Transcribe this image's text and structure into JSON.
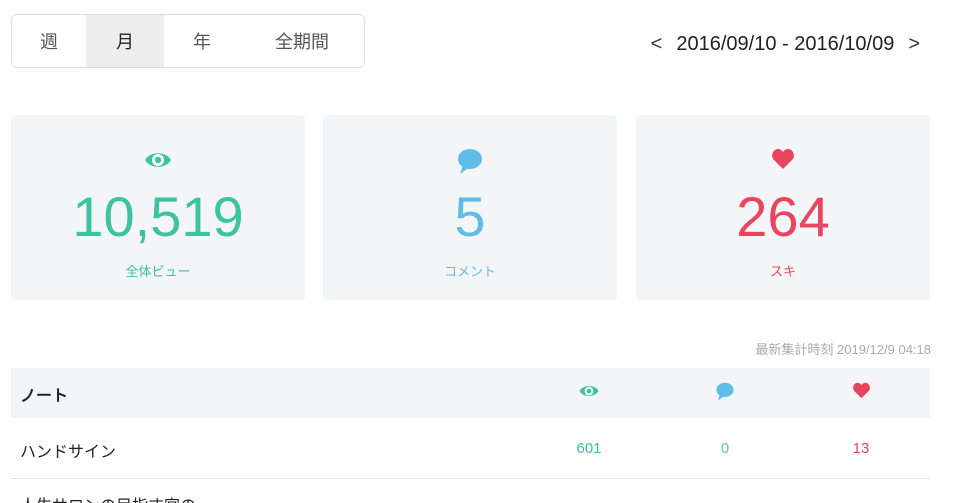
{
  "period_tabs": [
    {
      "label": "週",
      "active": false
    },
    {
      "label": "月",
      "active": true
    },
    {
      "label": "年",
      "active": false
    },
    {
      "label": "全期間",
      "active": false
    }
  ],
  "date_range": {
    "prev": "<",
    "text": "2016/09/10 - 2016/10/09",
    "next": ">"
  },
  "stats": {
    "views": {
      "value": "10,519",
      "label": "全体ビュー",
      "icon": "eye-icon",
      "color": "#3cc3a0"
    },
    "comments": {
      "value": "5",
      "label": "コメント",
      "icon": "comment-icon",
      "color": "#60bde8"
    },
    "likes": {
      "value": "264",
      "label": "スキ",
      "icon": "heart-icon",
      "color": "#ea4560"
    }
  },
  "updated_at": "最新集計時刻 2019/12/9 04:18",
  "table": {
    "header": "ノート",
    "rows": [
      {
        "title": "ハンドサイン",
        "views": "601",
        "comments": "0",
        "likes": "13"
      },
      {
        "title": "人生サロンの目指す宮の"
      }
    ]
  }
}
